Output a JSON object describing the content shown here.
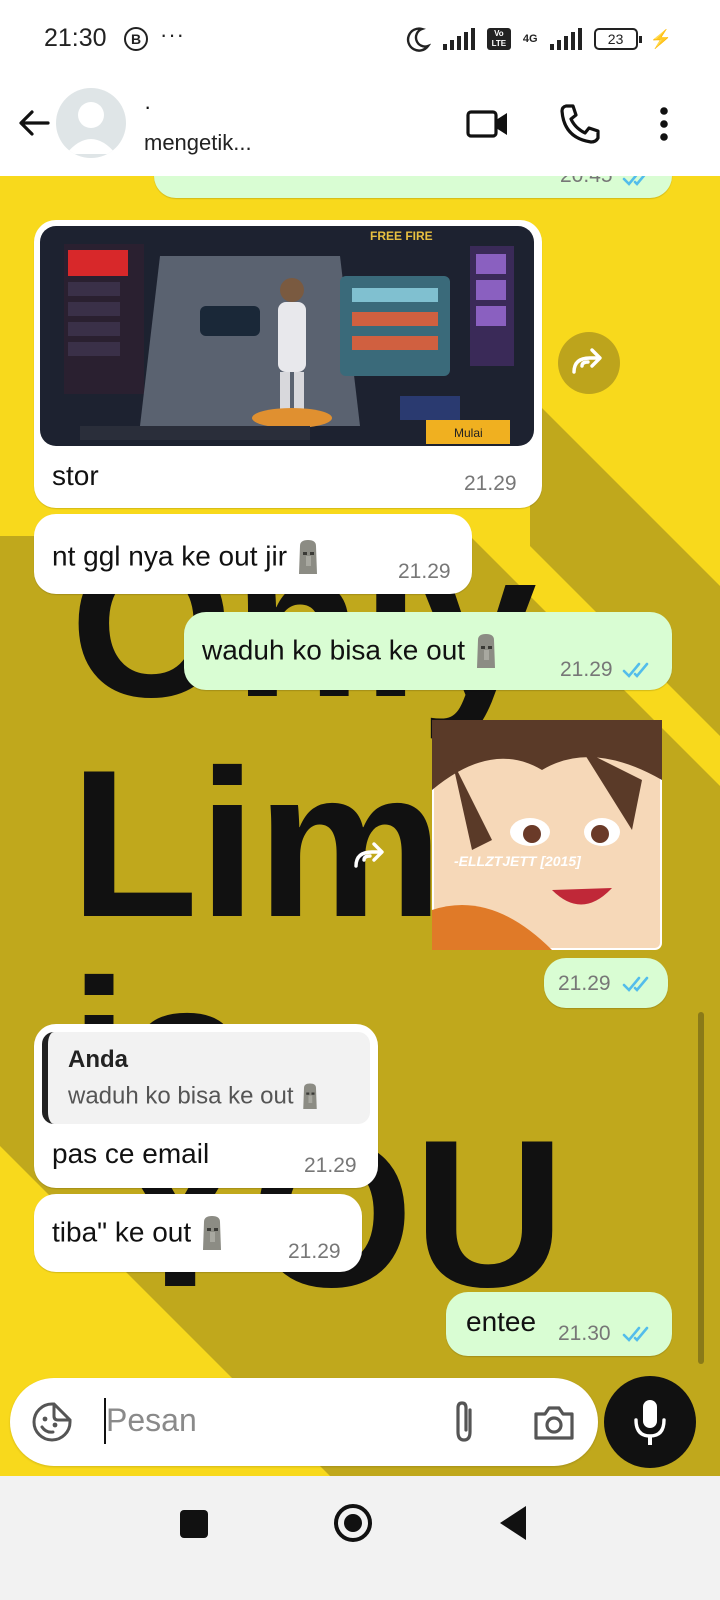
{
  "status_bar": {
    "time": "21:30",
    "notification_icon": "B",
    "more": "···",
    "network": "4G",
    "volte": "Vo LTE",
    "battery": "23"
  },
  "header": {
    "contact_name": "·",
    "contact_status": "mengetik..."
  },
  "messages": [
    {
      "partial_time": "20.45"
    },
    {
      "text": "stor",
      "time": "21.29"
    },
    {
      "text": "nt ggl nya ke out jir",
      "time": "21.29"
    },
    {
      "text": "waduh ko bisa ke out",
      "time": "21.29"
    },
    {
      "image_watermark": "-ELLZTJETT [2015]",
      "time": "21.29"
    },
    {
      "quote_author": "Anda",
      "quote_text": "waduh ko bisa ke out",
      "text": "pas ce email",
      "time": "21.29"
    },
    {
      "text": "tiba\" ke out",
      "time": "21.29"
    },
    {
      "text": "entee",
      "time": "21.30"
    }
  ],
  "game_screenshot": {
    "logo": "FREE FIRE",
    "start_button": "Mulai"
  },
  "input": {
    "placeholder": "Pesan"
  },
  "colors": {
    "wallpaper_yellow": "#f8d91c",
    "wallpaper_shadow": "#c0a81c",
    "outgoing_bubble": "#d9fdd3",
    "incoming_bubble": "#ffffff",
    "read_ticks": "#53bdeb"
  }
}
